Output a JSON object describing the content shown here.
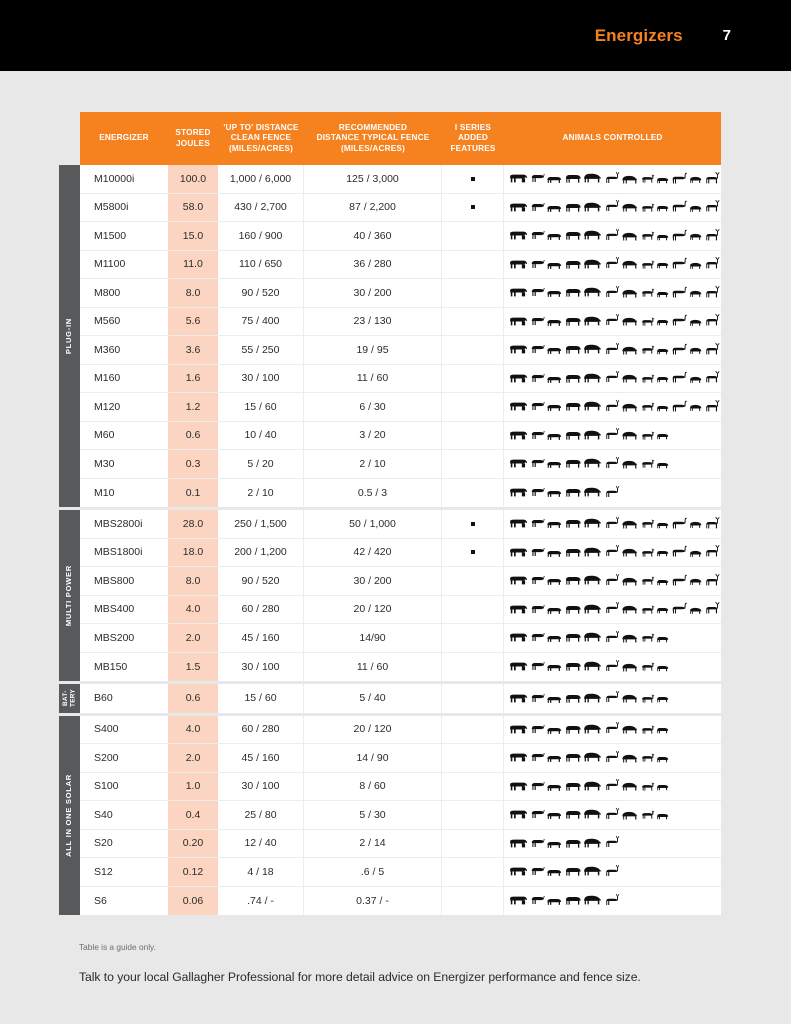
{
  "header": {
    "brand_title": "Energizers",
    "page_number": "7",
    "brand_color": "#F5821F",
    "bar_color": "#000000"
  },
  "table": {
    "header_bg": "#F5821F",
    "joules_cell_bg": "#FBD5C1",
    "group_label_bg": "#58595B",
    "columns": [
      "ENERGIZER",
      "STORED\nJOULES",
      "'UP TO' DISTANCE\nCLEAN FENCE\n(MILES/ACRES)",
      "RECOMMENDED\nDISTANCE TYPICAL FENCE\n(MILES/ACRES)",
      "I SERIES\nADDED\nFEATURES",
      "ANIMALS CONTROLLED"
    ],
    "columns_flat": {
      "energizer": "ENERGIZER",
      "stored_joules_l1": "STORED",
      "stored_joules_l2": "JOULES",
      "clean_l1": "'UP TO' DISTANCE",
      "clean_l2": "CLEAN FENCE",
      "clean_l3": "(MILES/ACRES)",
      "rec_l1": "RECOMMENDED",
      "rec_l2": "DISTANCE TYPICAL FENCE",
      "rec_l3": "(MILES/ACRES)",
      "iseries_l1": "I SERIES",
      "iseries_l2": "ADDED",
      "iseries_l3": "FEATURES",
      "animals": "ANIMALS CONTROLLED"
    },
    "groups": [
      {
        "label": "PLUG-IN",
        "label_lines": [
          "PLUG-IN"
        ],
        "rows": [
          {
            "energizer": "M10000i",
            "joules": "100.0",
            "clean": "1,000 / 6,000",
            "recommended": "125 / 3,000",
            "iseries": true,
            "animals": 14
          },
          {
            "energizer": "M5800i",
            "joules": "58.0",
            "clean": "430 / 2,700",
            "recommended": "87 / 2,200",
            "iseries": true,
            "animals": 14
          },
          {
            "energizer": "M1500",
            "joules": "15.0",
            "clean": "160 / 900",
            "recommended": "40 / 360",
            "iseries": false,
            "animals": 14
          },
          {
            "energizer": "M1100",
            "joules": "11.0",
            "clean": "110 / 650",
            "recommended": "36 / 280",
            "iseries": false,
            "animals": 14
          },
          {
            "energizer": "M800",
            "joules": "8.0",
            "clean": "90 / 520",
            "recommended": "30 / 200",
            "iseries": false,
            "animals": 14
          },
          {
            "energizer": "M560",
            "joules": "5.6",
            "clean": "75 / 400",
            "recommended": "23 / 130",
            "iseries": false,
            "animals": 14
          },
          {
            "energizer": "M360",
            "joules": "3.6",
            "clean": "55 / 250",
            "recommended": "19 / 95",
            "iseries": false,
            "animals": 12
          },
          {
            "energizer": "M160",
            "joules": "1.6",
            "clean": "30 / 100",
            "recommended": "11 / 60",
            "iseries": false,
            "animals": 12
          },
          {
            "energizer": "M120",
            "joules": "1.2",
            "clean": "15 / 60",
            "recommended": "6 / 30",
            "iseries": false,
            "animals": 12
          },
          {
            "energizer": "M60",
            "joules": "0.6",
            "clean": "10 / 40",
            "recommended": "3 / 20",
            "iseries": false,
            "animals": 9
          },
          {
            "energizer": "M30",
            "joules": "0.3",
            "clean": "5 / 20",
            "recommended": "2 / 10",
            "iseries": false,
            "animals": 9
          },
          {
            "energizer": "M10",
            "joules": "0.1",
            "clean": "2 / 10",
            "recommended": "0.5 / 3",
            "iseries": false,
            "animals": 6
          }
        ]
      },
      {
        "label": "MULTI POWER",
        "label_lines": [
          "MULTI POWER"
        ],
        "rows": [
          {
            "energizer": "MBS2800i",
            "joules": "28.0",
            "clean": "250 / 1,500",
            "recommended": "50 / 1,000",
            "iseries": true,
            "animals": 12
          },
          {
            "energizer": "MBS1800i",
            "joules": "18.0",
            "clean": "200 / 1,200",
            "recommended": "42 / 420",
            "iseries": true,
            "animals": 12
          },
          {
            "energizer": "MBS800",
            "joules": "8.0",
            "clean": "90 / 520",
            "recommended": "30 / 200",
            "iseries": false,
            "animals": 12
          },
          {
            "energizer": "MBS400",
            "joules": "4.0",
            "clean": "60 / 280",
            "recommended": "20 / 120",
            "iseries": false,
            "animals": 12
          },
          {
            "energizer": "MBS200",
            "joules": "2.0",
            "clean": "45 / 160",
            "recommended": "14/90",
            "iseries": false,
            "animals": 9
          },
          {
            "energizer": "MB150",
            "joules": "1.5",
            "clean": "30 / 100",
            "recommended": "11 / 60",
            "iseries": false,
            "animals": 9
          }
        ]
      },
      {
        "label": "BATTERY",
        "label_lines": [
          "BAT-",
          "TERY"
        ],
        "rows": [
          {
            "energizer": "B60",
            "joules": "0.6",
            "clean": "15 / 60",
            "recommended": "5 / 40",
            "iseries": false,
            "animals": 9
          }
        ]
      },
      {
        "label": "ALL IN ONE SOLAR",
        "label_lines": [
          "ALL IN ONE SOLAR"
        ],
        "rows": [
          {
            "energizer": "S400",
            "joules": "4.0",
            "clean": "60 / 280",
            "recommended": "20 / 120",
            "iseries": false,
            "animals": 9
          },
          {
            "energizer": "S200",
            "joules": "2.0",
            "clean": "45 / 160",
            "recommended": "14 / 90",
            "iseries": false,
            "animals": 9
          },
          {
            "energizer": "S100",
            "joules": "1.0",
            "clean": "30 / 100",
            "recommended": "8 / 60",
            "iseries": false,
            "animals": 9
          },
          {
            "energizer": "S40",
            "joules": "0.4",
            "clean": "25 / 80",
            "recommended": "5 / 30",
            "iseries": false,
            "animals": 9
          },
          {
            "energizer": "S20",
            "joules": "0.20",
            "clean": "12 / 40",
            "recommended": "2 / 14",
            "iseries": false,
            "animals": 6
          },
          {
            "energizer": "S12",
            "joules": "0.12",
            "clean": "4 / 18",
            "recommended": ".6 / 5",
            "iseries": false,
            "animals": 6
          },
          {
            "energizer": "S6",
            "joules": "0.06",
            "clean": ".74 / -",
            "recommended": "0.37 / -",
            "iseries": false,
            "animals": 6
          }
        ]
      }
    ]
  },
  "footer": {
    "note": "Table is a guide only.",
    "blurb": "Talk to your local Gallagher Professional for more detail advice on Energizer performance and fence size."
  }
}
